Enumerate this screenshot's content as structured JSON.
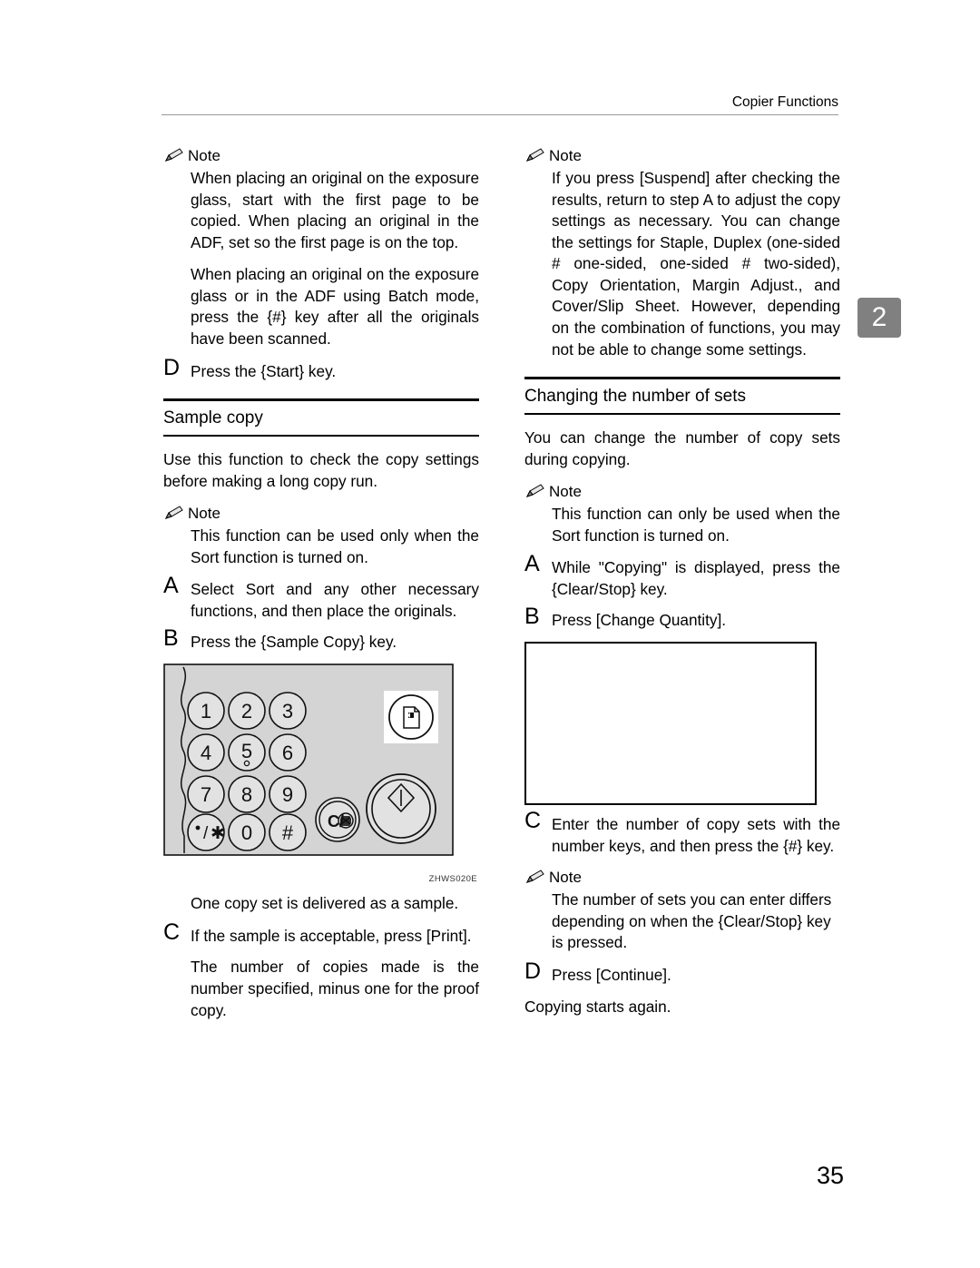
{
  "header": {
    "title": "Copier Functions"
  },
  "chapter_tab": {
    "number": "2"
  },
  "page_number": "35",
  "icons": {
    "note": "pencil-icon"
  },
  "left_column": {
    "note1": {
      "label": "Note",
      "paragraphs": [
        "When placing an original on the exposure glass, start with the first page to be copied. When placing an original in the ADF, set so the first page is on the top.",
        "When placing an original on the exposure glass or in the ADF using Batch mode, press the {#} key after all the originals have been scanned."
      ]
    },
    "step_d": {
      "letter": "D",
      "text": "Press the {Start} key."
    },
    "section": {
      "heading": "Sample copy"
    },
    "intro": "Use this function to check the copy settings before making a long copy run.",
    "note2": {
      "label": "Note",
      "paragraphs": [
        "This function can be used only when the Sort function is turned on."
      ]
    },
    "step_a": {
      "letter": "A",
      "text": "Select Sort and any other necessary functions, and then place the originals."
    },
    "step_b": {
      "letter": "B",
      "text": "Press the {Sample Copy} key."
    },
    "figure": {
      "label": "ZHWS020E",
      "keys": [
        "1",
        "2",
        "3",
        "4",
        "5",
        "6",
        "7",
        "8",
        "9",
        "•/✳",
        "0",
        "#"
      ],
      "clear_stop_label": "C/",
      "start_label": "start-key",
      "sample_copy_label": "sample-copy-key"
    },
    "after_figure": "One copy set is delivered as a sample.",
    "step_c": {
      "letter": "C",
      "text": "If the sample is acceptable, press [Print]."
    },
    "after_c": "The number of copies made is the number specified, minus one for the proof copy."
  },
  "right_column": {
    "note1": {
      "label": "Note",
      "paragraphs": [
        "If you press [Suspend] after checking the results, return to step A to adjust the copy settings as necessary. You can change the settings for Staple, Duplex (one-sided # one-sided, one-sided # two-sided), Copy Orientation, Margin Adjust., and Cover/Slip Sheet. However, depending on the combination of functions, you may not be able to change some settings."
      ]
    },
    "section": {
      "heading": "Changing the number of sets"
    },
    "intro": "You can change the number of copy sets during copying.",
    "note2": {
      "label": "Note",
      "paragraphs": [
        "This function can only be used when the Sort function is turned on."
      ]
    },
    "step_a": {
      "letter": "A",
      "text": "While \"Copying\" is displayed, press the {Clear/Stop} key."
    },
    "step_b": {
      "letter": "B",
      "text": "Press [Change Quantity]."
    },
    "screen_box": {
      "content": ""
    },
    "step_c": {
      "letter": "C",
      "text": "Enter the number of copy sets with the number keys, and then press the {#} key."
    },
    "note3": {
      "label": "Note",
      "paragraphs": [
        "The number of sets you can enter differs depending on when the {Clear/Stop} key is pressed."
      ]
    },
    "step_d": {
      "letter": "D",
      "text": "Press [Continue]."
    },
    "after_d": "Copying starts again."
  }
}
